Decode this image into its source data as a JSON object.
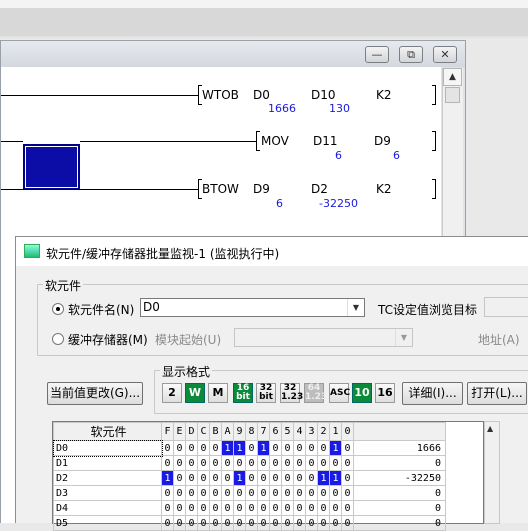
{
  "ladder": {
    "rungs": [
      {
        "instruction": "WTOB",
        "op1": "D0",
        "op1_val": "1666",
        "op2": "D10",
        "op2_val": "130",
        "op3": "K2"
      },
      {
        "instruction": "MOV",
        "op1": "D11",
        "op1_val": "6",
        "op2": "D9",
        "op2_val": "6",
        "op3": ""
      },
      {
        "instruction": "BTOW",
        "op1": "D9",
        "op1_val": "6",
        "op2": "D2",
        "op2_val": "-32250",
        "op3": "K2"
      }
    ],
    "caption_buttons": [
      "—",
      "⧉",
      "✕"
    ]
  },
  "monitor": {
    "title": "软元件/缓冲存储器批量监视-1 (监视执行中)",
    "group_label": "软元件",
    "device_radio_label": "软元件名(N)",
    "device_value": "D0",
    "buffer_radio_label": "缓冲存储器(M)",
    "module_start_label": "模块起始(U)",
    "tc_label": "TC设定值浏览目标",
    "address_label": "地址(A)",
    "display_format_label": "显示格式",
    "change_value_button": "当前值更改(G)...",
    "format_buttons": [
      "2",
      "W",
      "M",
      "16\nbit",
      "32\nbit",
      "32\n1.23",
      "64\n1.23",
      "ASC",
      "10",
      "16"
    ],
    "detail_button": "详细(I)...",
    "open_button": "打开(L)...",
    "grid": {
      "device_header": "软元件",
      "bit_headers": [
        "F",
        "E",
        "D",
        "C",
        "B",
        "A",
        "9",
        "8",
        "7",
        "6",
        "5",
        "4",
        "3",
        "2",
        "1",
        "0"
      ],
      "rows": [
        {
          "device": "D0",
          "bits": [
            0,
            0,
            0,
            0,
            0,
            1,
            1,
            0,
            1,
            0,
            0,
            0,
            0,
            0,
            1,
            0
          ],
          "value": "1666"
        },
        {
          "device": "D1",
          "bits": [
            0,
            0,
            0,
            0,
            0,
            0,
            0,
            0,
            0,
            0,
            0,
            0,
            0,
            0,
            0,
            0
          ],
          "value": "0"
        },
        {
          "device": "D2",
          "bits": [
            1,
            0,
            0,
            0,
            0,
            0,
            1,
            0,
            0,
            0,
            0,
            0,
            0,
            1,
            1,
            0
          ],
          "value": "-32250"
        },
        {
          "device": "D3",
          "bits": [
            0,
            0,
            0,
            0,
            0,
            0,
            0,
            0,
            0,
            0,
            0,
            0,
            0,
            0,
            0,
            0
          ],
          "value": "0"
        },
        {
          "device": "D4",
          "bits": [
            0,
            0,
            0,
            0,
            0,
            0,
            0,
            0,
            0,
            0,
            0,
            0,
            0,
            0,
            0,
            0
          ],
          "value": "0"
        },
        {
          "device": "D5",
          "bits": [
            0,
            0,
            0,
            0,
            0,
            0,
            0,
            0,
            0,
            0,
            0,
            0,
            0,
            0,
            0,
            0
          ],
          "value": "0"
        }
      ]
    }
  }
}
